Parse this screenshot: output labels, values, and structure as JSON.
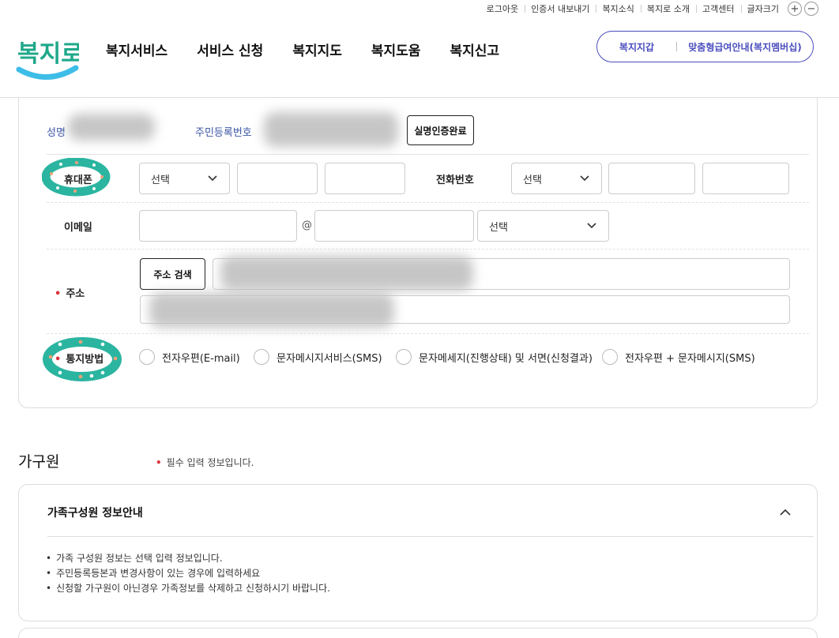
{
  "util_bar": {
    "items": [
      "로그아웃",
      "인증서 내보내기",
      "복지소식",
      "복지로 소개",
      "고객센터",
      "글자크기"
    ],
    "font_plus": "+",
    "font_minus": "−"
  },
  "header": {
    "logo_text": "복지로",
    "nav": [
      "복지서비스",
      "서비스 신청",
      "복지지도",
      "복지도움",
      "복지신고"
    ],
    "pill_left": "복지지갑",
    "pill_right": "맞춤형급여안내(복지멤버십)"
  },
  "form": {
    "name_label": "성명",
    "rrn_label": "주민등록번호",
    "verify_button": "실명인증완료",
    "mobile_label": "휴대폰",
    "mobile_select": "선택",
    "phone_label": "전화번호",
    "phone_select": "선택",
    "email_label": "이메일",
    "email_at": "@",
    "email_domain_select": "선택",
    "address_label": "주소",
    "address_search_button": "주소 검색",
    "notify_label": "통지방법",
    "notify_options": [
      "전자우편(E-mail)",
      "문자메시지서비스(SMS)",
      "문자메세지(진행상태) 및 서면(신청결과)",
      "전자우편 + 문자메시지(SMS)"
    ]
  },
  "family": {
    "title": "가구원",
    "required_note": "필수 입력 정보입니다.",
    "info_title": "가족구성원 정보안내",
    "bullets": [
      "가족 구성원 정보는 선택 입력 정보입니다.",
      "주민등록등본과 변경사항이 있는 경우에 입력하세요",
      "신청할 가구원이 아닌경우 가족정보를 삭제하고 신청하시기 바랍니다."
    ]
  },
  "colors": {
    "brand_blue": "#3a55a5",
    "pill_purple": "#4a4dbd",
    "required_red": "#d9363e",
    "scribble_teal": "#2bb5a0",
    "logo_teal": "#1fa88a",
    "logo_sky": "#3dbde8"
  }
}
